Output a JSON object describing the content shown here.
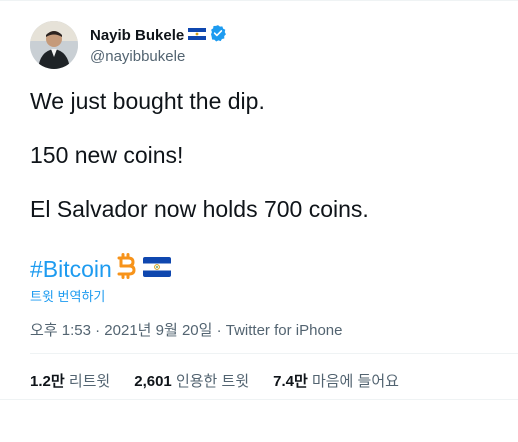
{
  "author": {
    "name": "Nayib Bukele",
    "handle": "@nayibbukele"
  },
  "tweet": {
    "lines": [
      "We just bought the dip.",
      "150 new coins!",
      "El Salvador now holds 700 coins."
    ],
    "hashtag": "#Bitcoin",
    "translate_label": "트윗 번역하기",
    "timestamp": "오후 1:53 · 2021년 9월 20일 · Twitter for iPhone"
  },
  "stats": {
    "retweets_count": "1.2만",
    "retweets_label": "리트윗",
    "quotes_count": "2,601",
    "quotes_label": "인용한 트윗",
    "likes_count": "7.4만",
    "likes_label": "마음에 들어요"
  },
  "colors": {
    "link": "#1d9bf0",
    "secondary": "#536471",
    "flag_blue": "#0f47af",
    "bitcoin_orange": "#f7931a"
  },
  "icons": [
    "el-salvador-flag-icon",
    "verified-badge-icon",
    "bitcoin-icon"
  ]
}
